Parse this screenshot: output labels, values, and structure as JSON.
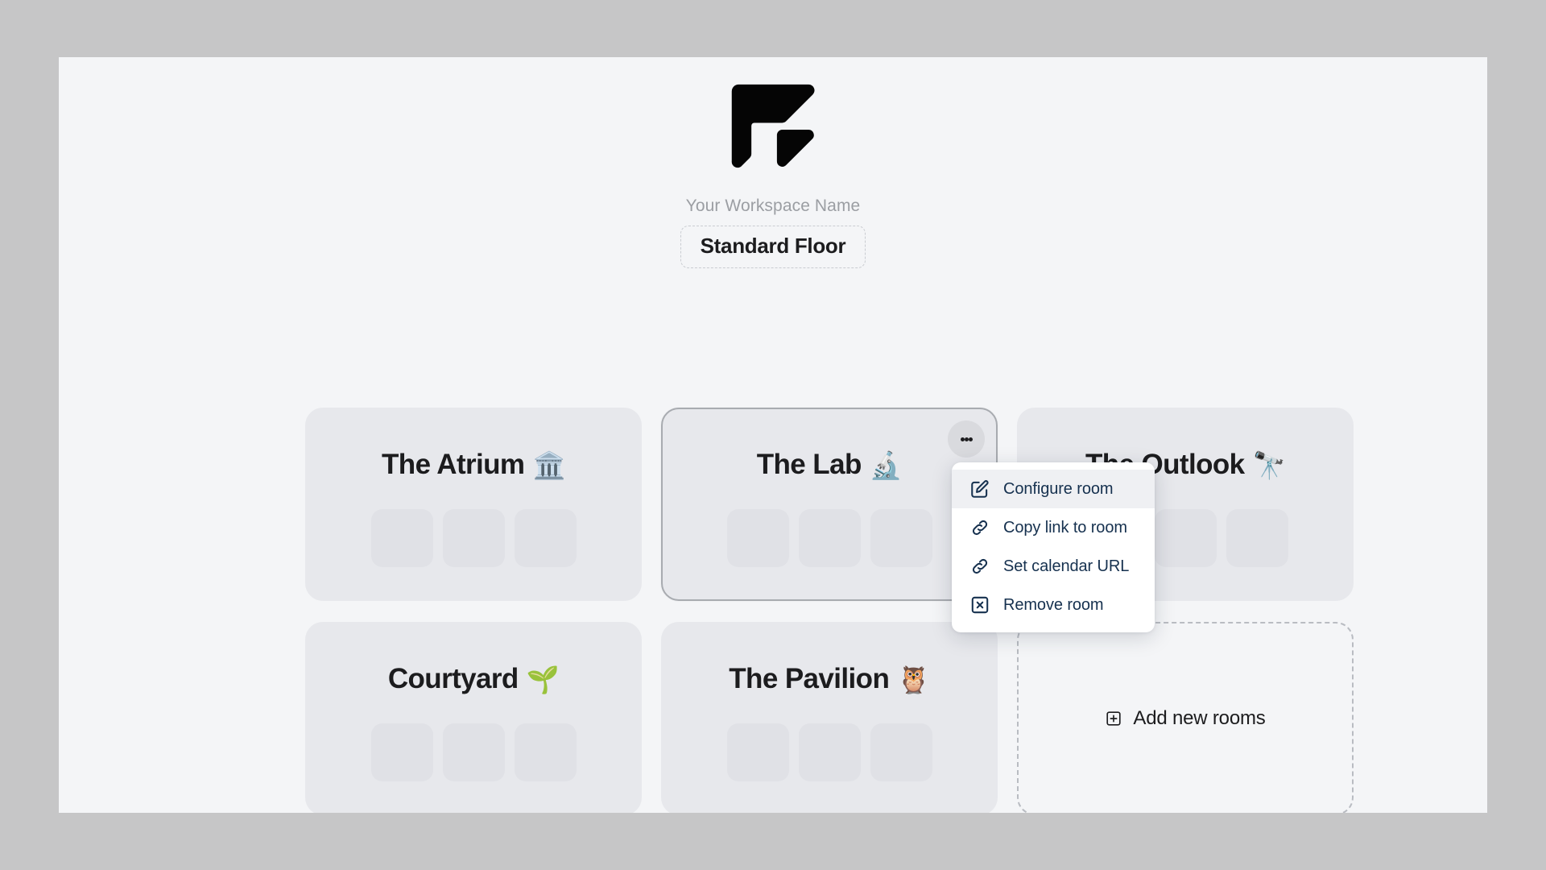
{
  "window": {
    "outer_bg": "#c6c6c7",
    "page_bg": "#f4f5f7"
  },
  "header": {
    "logo_name": "workspace-logo",
    "logo_color": "#050505",
    "workspace_name": "Your Workspace Name",
    "floor_label": "Standard Floor"
  },
  "rooms": [
    {
      "name": "The Atrium",
      "emoji": "🏛️",
      "emoji_name": "classical-building-emoji",
      "slots": 3,
      "selected": false
    },
    {
      "name": "The Lab",
      "emoji": "🔬",
      "emoji_name": "microscope-emoji",
      "slots": 3,
      "selected": true
    },
    {
      "name": "The Outlook",
      "emoji": "🔭",
      "emoji_name": "telescope-emoji",
      "slots": 3,
      "selected": false
    },
    {
      "name": "Courtyard",
      "emoji": "🌱",
      "emoji_name": "seedling-emoji",
      "slots": 3,
      "selected": false
    },
    {
      "name": "The Pavilion",
      "emoji": "🦉",
      "emoji_name": "owl-emoji",
      "slots": 3,
      "selected": false
    }
  ],
  "add_rooms": {
    "label": "Add new rooms",
    "icon": "square-plus-icon"
  },
  "kebab": {
    "icon": "three-dots-vertical-icon",
    "dots": 3
  },
  "context_menu": {
    "items": [
      {
        "label": "Configure room",
        "icon": "edit-square-icon",
        "active": true
      },
      {
        "label": "Copy link to room",
        "icon": "link-icon",
        "active": false
      },
      {
        "label": "Set calendar URL",
        "icon": "link-icon",
        "active": false
      },
      {
        "label": "Remove room",
        "icon": "close-square-icon",
        "active": false
      }
    ],
    "text_color": "#16314f",
    "highlight_color": "#eff0f3"
  }
}
